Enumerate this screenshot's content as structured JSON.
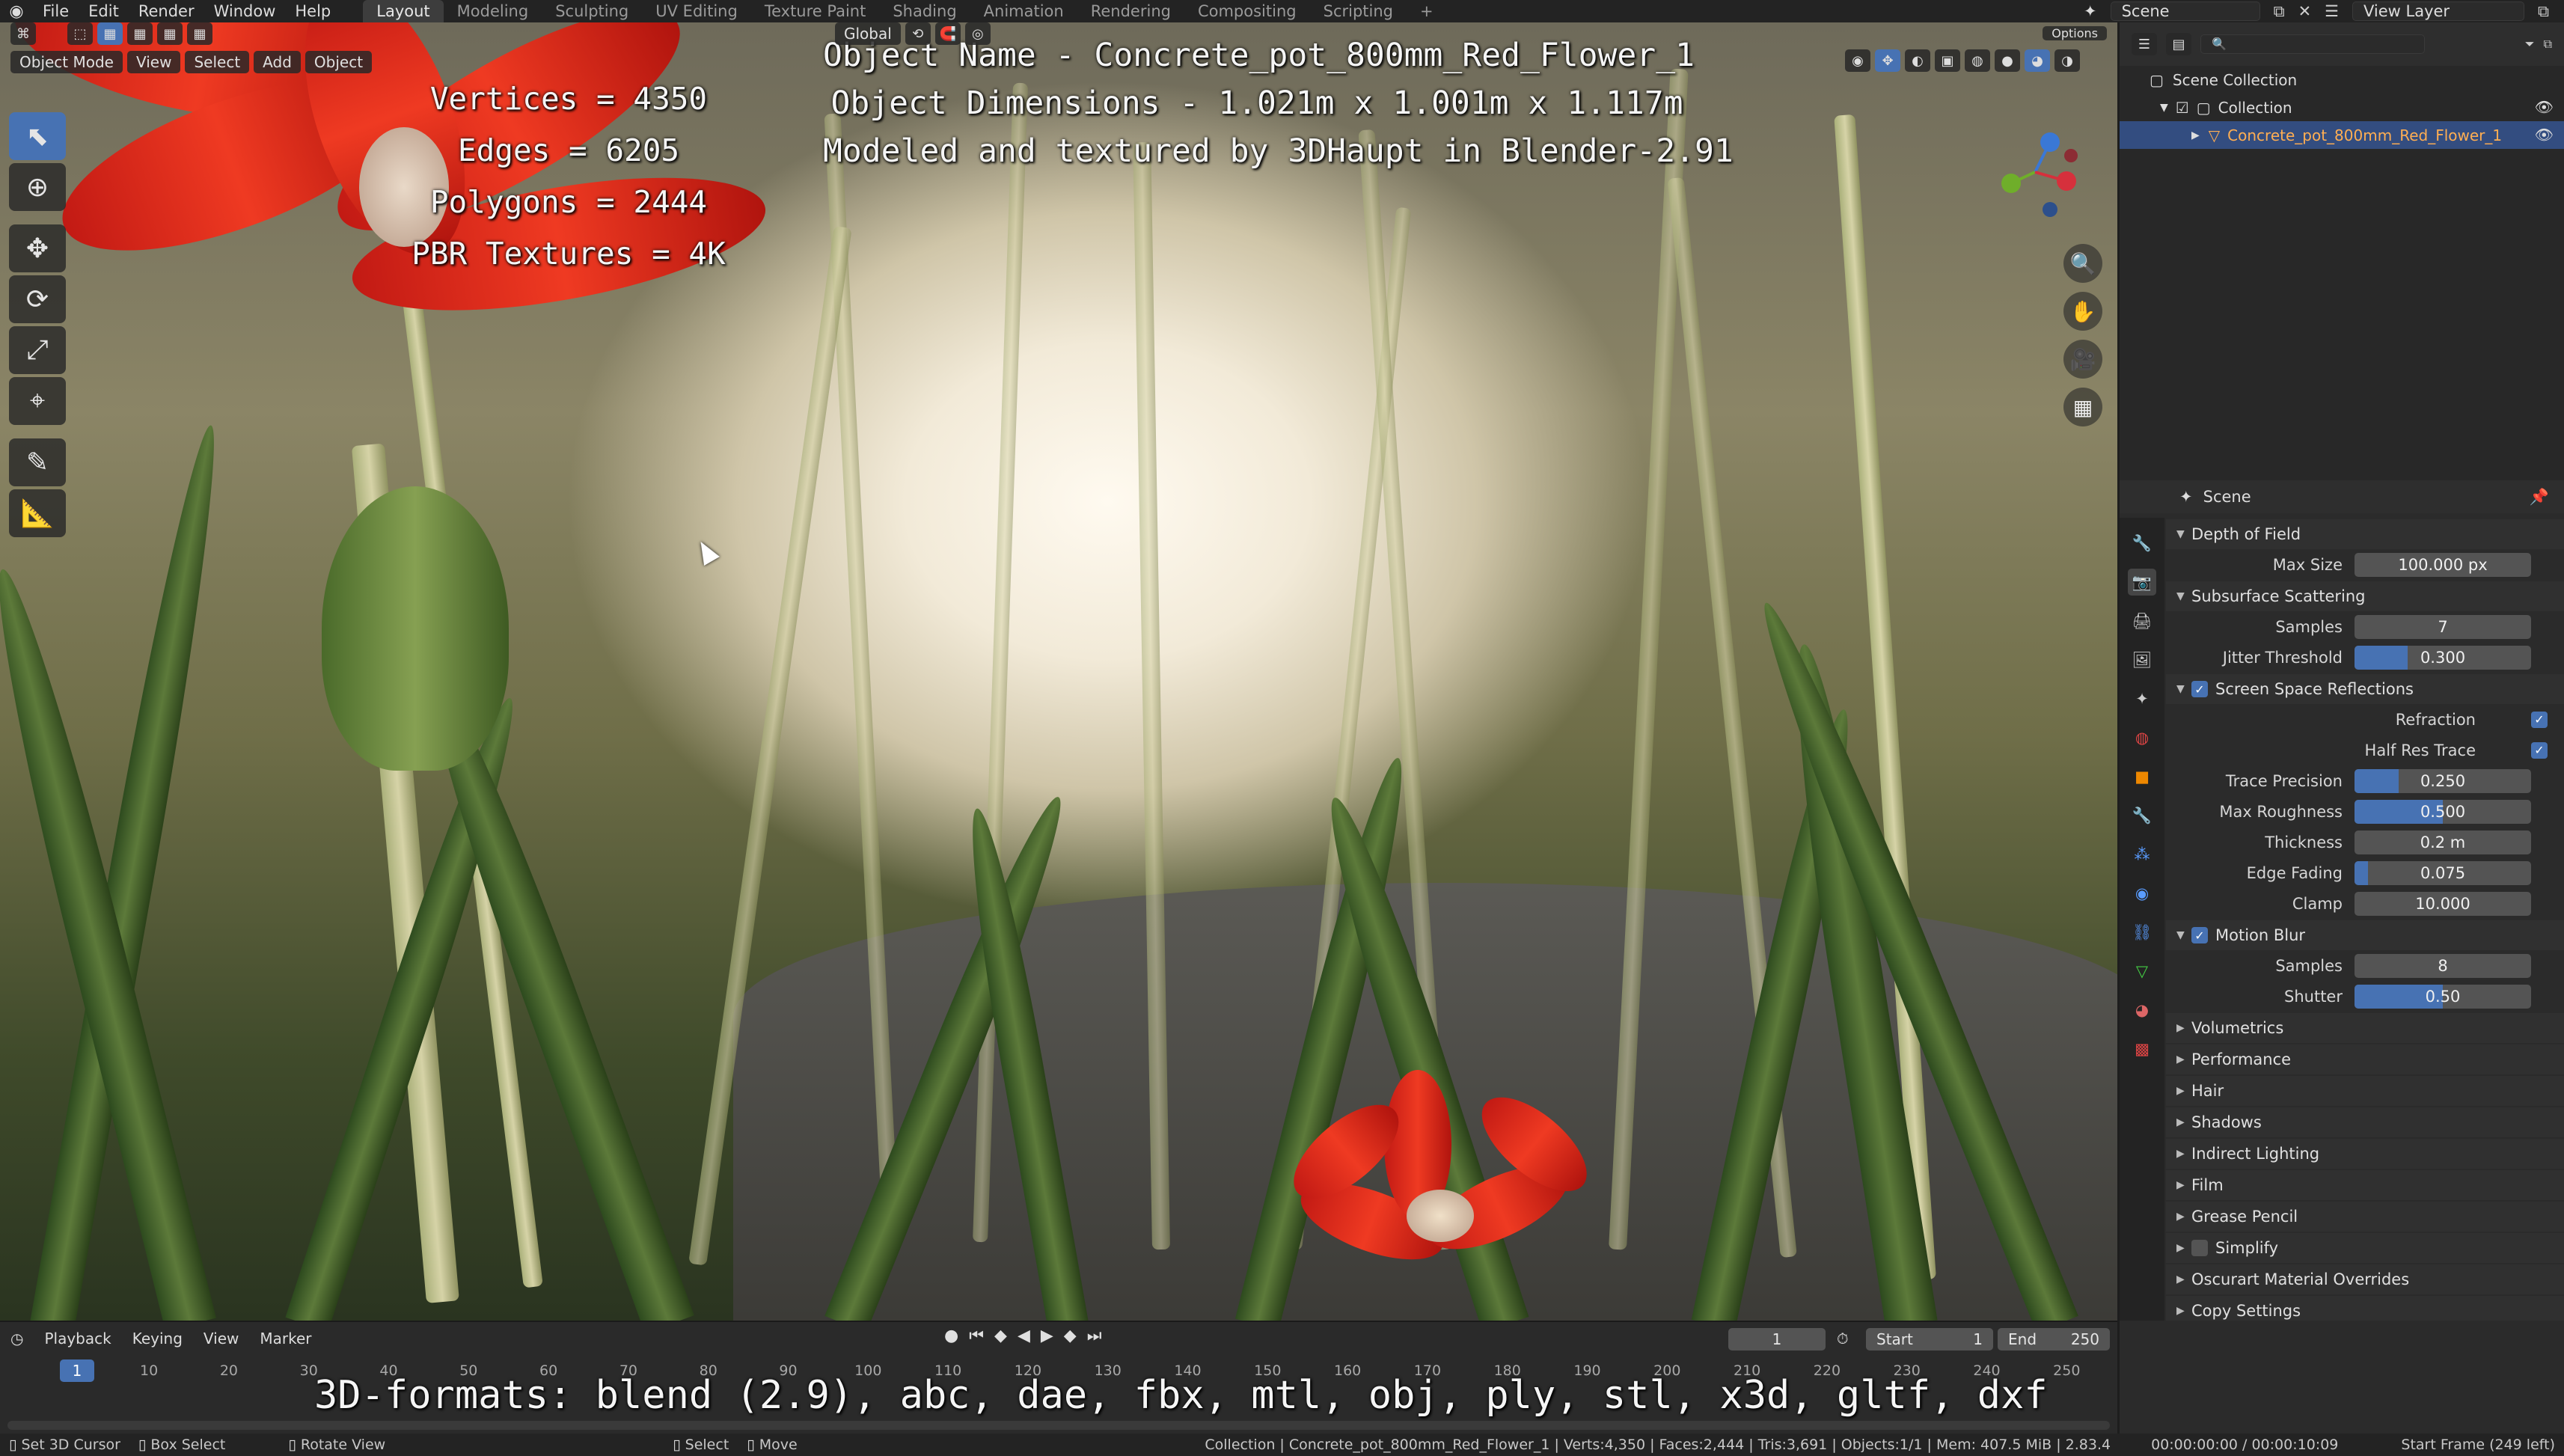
{
  "topbar": {
    "menus": [
      "File",
      "Edit",
      "Render",
      "Window",
      "Help"
    ],
    "workspaces": [
      "Layout",
      "Modeling",
      "Sculpting",
      "UV Editing",
      "Texture Paint",
      "Shading",
      "Animation",
      "Rendering",
      "Compositing",
      "Scripting"
    ],
    "active_workspace": "Layout",
    "scene": "Scene",
    "view_layer": "View Layer"
  },
  "viewport": {
    "mode": "Object Mode",
    "menus": [
      "View",
      "Select",
      "Add",
      "Object"
    ],
    "orientation": "Global",
    "options_label": "Options"
  },
  "overlay": {
    "vertices": "Vertices = 4350",
    "edges": "Edges = 6205",
    "polygons": "Polygons = 2444",
    "textures": "PBR Textures = 4K",
    "object_name": "Object Name - Concrete_pot_800mm_Red_Flower_1",
    "dimensions": "Object Dimensions -  1.021m x 1.001m x 1.117m",
    "credit": "Modeled and textured by 3DHaupt in Blender-2.91",
    "formats": "3D-formats: blend (2.9), abc, dae, fbx, mtl, obj, ply, stl, x3d, gltf, dxf"
  },
  "outliner": {
    "root": "Scene Collection",
    "collection": "Collection",
    "object": "Concrete_pot_800mm_Red_Flower_1"
  },
  "properties": {
    "context": "Scene",
    "sections": {
      "dof": {
        "title": "Depth of Field",
        "max_size_label": "Max Size",
        "max_size": "100.000 px"
      },
      "sss": {
        "title": "Subsurface Scattering",
        "samples_label": "Samples",
        "samples": "7",
        "jitter_label": "Jitter Threshold",
        "jitter": "0.300",
        "jitter_frac": 0.3
      },
      "ssr": {
        "title": "Screen Space Reflections",
        "refraction_label": "Refraction",
        "half_res_label": "Half Res Trace",
        "trace_precision_label": "Trace Precision",
        "trace_precision": "0.250",
        "trace_precision_frac": 0.25,
        "max_roughness_label": "Max Roughness",
        "max_roughness": "0.500",
        "max_roughness_frac": 0.5,
        "thickness_label": "Thickness",
        "thickness": "0.2 m",
        "edge_fading_label": "Edge Fading",
        "edge_fading": "0.075",
        "edge_fading_frac": 0.075,
        "clamp_label": "Clamp",
        "clamp": "10.000"
      },
      "mblur": {
        "title": "Motion Blur",
        "samples_label": "Samples",
        "samples": "8",
        "shutter_label": "Shutter",
        "shutter": "0.50",
        "shutter_frac": 0.5
      },
      "collapsed": [
        "Volumetrics",
        "Performance",
        "Hair",
        "Shadows",
        "Indirect Lighting",
        "Film",
        "Grease Pencil",
        "Simplify",
        "Oscurart Material Overrides",
        "Copy Settings"
      ]
    }
  },
  "timeline": {
    "menus": [
      "Playback",
      "Keying",
      "View",
      "Marker"
    ],
    "current_frame": "1",
    "start_label": "Start",
    "start": "1",
    "end_label": "End",
    "end": "250",
    "ticks": [
      "10",
      "20",
      "30",
      "40",
      "50",
      "60",
      "70",
      "80",
      "90",
      "100",
      "110",
      "120",
      "130",
      "140",
      "150",
      "160",
      "170",
      "180",
      "190",
      "200",
      "210",
      "220",
      "230",
      "240",
      "250"
    ]
  },
  "statusbar": {
    "set_cursor": "Set 3D Cursor",
    "box_select": "Box Select",
    "rotate_view": "Rotate View",
    "select": "Select",
    "move": "Move",
    "info": "Collection | Concrete_pot_800mm_Red_Flower_1 | Verts:4,350 | Faces:2,444 | Tris:3,691 | Objects:1/1 | Mem: 407.5 MiB | 2.83.4",
    "time": "00:00:00:00 / 00:00:10:09",
    "start_frame": "Start Frame (249 left)"
  },
  "colors": {
    "accent": "#4772b3",
    "selected_text": "#ffae52",
    "panel_bg": "#2b2b2b"
  }
}
